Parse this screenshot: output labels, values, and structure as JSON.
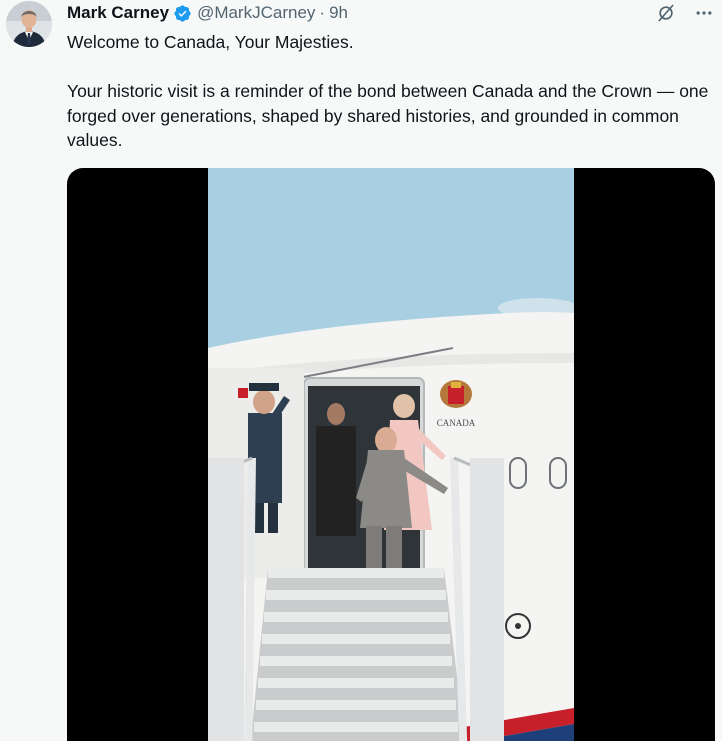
{
  "author": {
    "display_name": "Mark Carney",
    "handle": "@MarkJCarney",
    "separator": "·",
    "time": "9h",
    "verified_color": "#1d9bf0"
  },
  "icons": {
    "verified": "verified-badge-icon",
    "grok": "grok-icon",
    "more": "more-icon"
  },
  "tweet": {
    "line1": "Welcome to Canada, Your Majesties.",
    "line2": "Your historic visit is a reminder of the bond between Canada and the Crown — one forged over generations, shaped by shared histories, and grounded in common values."
  },
  "media": {
    "aircraft_text": "CANADA"
  },
  "colors": {
    "accent": "#1d9bf0",
    "secondary_text": "#536471",
    "sky": "#a9cfe3",
    "fuselage": "#f4f4f2"
  }
}
